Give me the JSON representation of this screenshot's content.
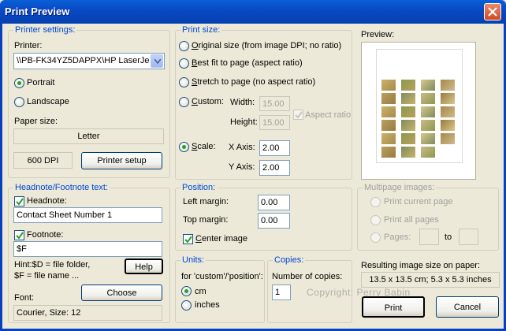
{
  "window": {
    "title": "Print Preview"
  },
  "printer_settings": {
    "group_label": "Printer settings:",
    "printer_label": "Printer:",
    "printer_value": "\\\\PB-FK34YZ5DAPPX\\HP LaserJe",
    "portrait_label": "Portrait",
    "landscape_label": "Landscape",
    "orientation_selected": "Portrait",
    "paper_size_label": "Paper size:",
    "paper_size_value": "Letter",
    "dpi_value": "600 DPI",
    "printer_setup_label": "Printer setup"
  },
  "print_size": {
    "group_label": "Print size:",
    "original_label": "Original size (from image DPI; no ratio)",
    "best_fit_label": "Best fit to page (aspect ratio)",
    "stretch_label": "Stretch to page (no aspect ratio)",
    "custom_label": "Custom:",
    "width_label": "Width:",
    "width_value": "15.00",
    "height_label": "Height:",
    "height_value": "15.00",
    "aspect_ratio_label": "Aspect ratio",
    "scale_label": "Scale:",
    "x_axis_label": "X Axis:",
    "x_axis_value": "2.00",
    "y_axis_label": "Y Axis:",
    "y_axis_value": "2.00",
    "selected": "Scale"
  },
  "preview": {
    "label": "Preview:"
  },
  "headnote": {
    "group_label": "Headnote/Footnote text:",
    "headnote_label": "Headnote:",
    "headnote_checked": true,
    "headnote_value": "Contact Sheet Number 1",
    "footnote_label": "Footnote:",
    "footnote_checked": true,
    "footnote_value": "$F",
    "hint_line1": "Hint:$D = file folder,",
    "hint_line2": "$F = file name ...",
    "help_label": "Help",
    "font_label": "Font:",
    "choose_label": "Choose",
    "font_value": "Courier, Size: 12"
  },
  "position": {
    "group_label": "Position:",
    "left_margin_label": "Left margin:",
    "left_margin_value": "0.00",
    "top_margin_label": "Top margin:",
    "top_margin_value": "0.00",
    "center_image_label": "Center image",
    "center_image_checked": true
  },
  "multipage": {
    "group_label": "Multipage images:",
    "print_current_label": "Print current page",
    "print_all_label": "Print all pages",
    "pages_label": "Pages:",
    "to_label": "to"
  },
  "units": {
    "group_label": "Units:",
    "for_label": "for 'custom'/'position':",
    "cm_label": "cm",
    "inches_label": "inches",
    "selected": "cm"
  },
  "copies": {
    "group_label": "Copies:",
    "number_label": "Number of copies:",
    "value": "1"
  },
  "result": {
    "label": "Resulting image size on paper:",
    "value": "13.5 x 13.5 cm; 5.3 x 5.3 inches"
  },
  "watermark": "Copyright: Perry Babin",
  "buttons": {
    "print_label": "Print",
    "cancel_label": "Cancel"
  },
  "colors": {
    "titlebar": "#0848c2",
    "group_label": "#0046d5",
    "face": "#ece9d8",
    "radio_dot": "#21a121"
  }
}
